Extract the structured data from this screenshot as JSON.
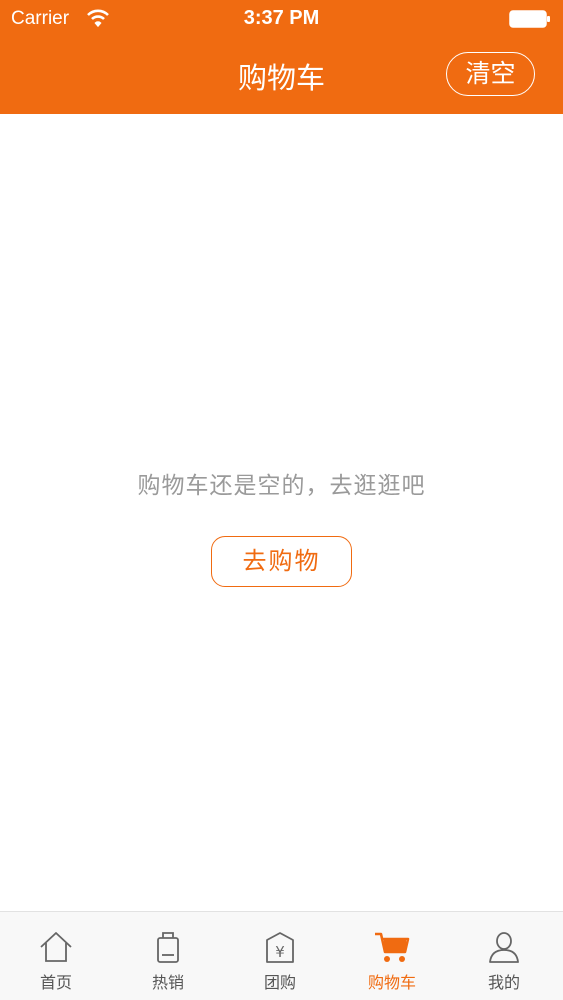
{
  "status_bar": {
    "carrier": "Carrier",
    "time": "3:37 PM"
  },
  "nav": {
    "title": "购物车",
    "clear_label": "清空"
  },
  "main": {
    "empty_message": "购物车还是空的，去逛逛吧",
    "go_shopping_label": "去购物"
  },
  "tabbar": {
    "items": [
      {
        "label": "首页",
        "icon": "home-icon"
      },
      {
        "label": "热销",
        "icon": "bag-icon"
      },
      {
        "label": "团购",
        "icon": "group-buy-icon"
      },
      {
        "label": "购物车",
        "icon": "cart-icon",
        "active": true
      },
      {
        "label": "我的",
        "icon": "user-icon"
      }
    ]
  },
  "colors": {
    "accent": "#f06b11",
    "text_muted": "#9a9a9a",
    "tab_inactive": "#555555"
  }
}
